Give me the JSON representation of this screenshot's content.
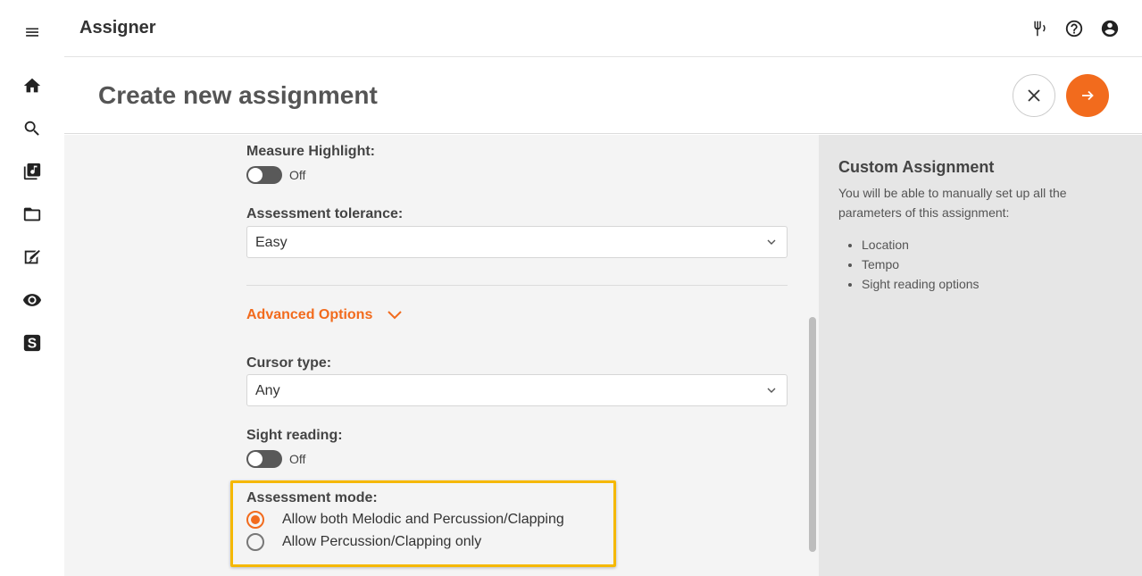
{
  "app": {
    "title": "Assigner"
  },
  "rail": {
    "icons": [
      "menu-icon",
      "home-icon",
      "search-icon",
      "music-library-icon",
      "folder-icon",
      "assignment-icon",
      "eye-icon",
      "s-logo-icon"
    ]
  },
  "appbar": {
    "icons": [
      "tuner-icon",
      "help-icon",
      "account-icon"
    ]
  },
  "page": {
    "title": "Create new assignment"
  },
  "form": {
    "measure_highlight": {
      "label": "Measure Highlight:",
      "state": "Off"
    },
    "assessment_tolerance": {
      "label": "Assessment tolerance:",
      "value": "Easy"
    },
    "advanced_options": {
      "label": "Advanced Options"
    },
    "cursor_type": {
      "label": "Cursor type:",
      "value": "Any"
    },
    "sight_reading": {
      "label": "Sight reading:",
      "state": "Off"
    },
    "assessment_mode": {
      "label": "Assessment mode:",
      "options": [
        {
          "label": "Allow both Melodic and Percussion/Clapping",
          "checked": true
        },
        {
          "label": "Allow Percussion/Clapping only",
          "checked": false
        }
      ]
    }
  },
  "side": {
    "title": "Custom Assignment",
    "description": "You will be able to manually set up all the parameters of this assignment:",
    "items": [
      "Location",
      "Tempo",
      "Sight reading options"
    ]
  },
  "colors": {
    "accent": "#f26b1d",
    "highlight": "#f5b800"
  }
}
